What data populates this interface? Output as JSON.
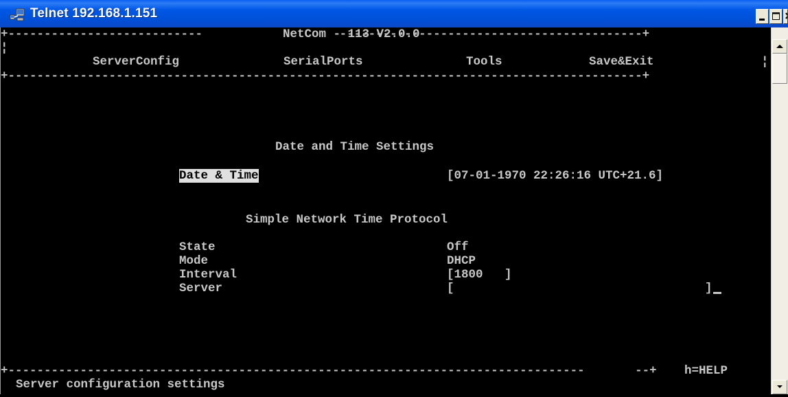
{
  "window": {
    "title": "Telnet 192.168.1.151"
  },
  "menu": {
    "title": "NetCom - 113 V2.0.0",
    "items": [
      "ServerConfig",
      "SerialPorts",
      "Tools",
      "Save&Exit"
    ]
  },
  "settings": {
    "heading": "Date and Time Settings",
    "date_time_label": "Date & Time",
    "date_time_value": "[07-01-1970 22:26:16 UTC+21.6]",
    "sntp_heading": "Simple Network Time Protocol",
    "state_label": "State",
    "state_value": "Off",
    "mode_label": "Mode",
    "mode_value": "DHCP",
    "interval_label": "Interval",
    "interval_value": "[1800   ]",
    "server_label": "Server",
    "server_value_open": "[",
    "server_value_close": "]"
  },
  "footer": {
    "help_hint": "h=HELP",
    "status": "Server configuration settings"
  }
}
